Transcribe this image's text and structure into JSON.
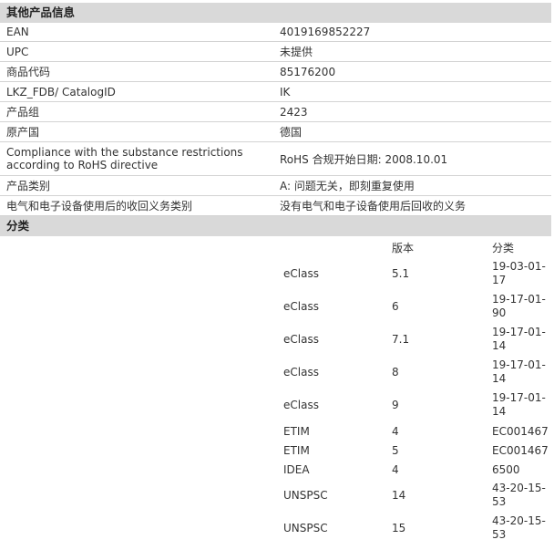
{
  "other_info": {
    "title": "其他产品信息",
    "rows": [
      {
        "label": "EAN",
        "value": "4019169852227"
      },
      {
        "label": "UPC",
        "value": "未提供"
      },
      {
        "label": "商品代码",
        "value": "85176200"
      },
      {
        "label": "LKZ_FDB/ CatalogID",
        "value": "IK"
      },
      {
        "label": "产品组",
        "value": "2423"
      },
      {
        "label": "原产国",
        "value": "德国"
      },
      {
        "label": "Compliance with the substance restrictions according to RoHS directive",
        "value": "RoHS 合规开始日期: 2008.10.01"
      },
      {
        "label": "产品类别",
        "value": "A: 问题无关，即刻重复使用"
      },
      {
        "label": "电气和电子设备使用后的收回义务类别",
        "value": "没有电气和电子设备使用后回收的义务"
      }
    ]
  },
  "classification": {
    "title": "分类",
    "col_version": "版本",
    "col_category": "分类",
    "rows": [
      {
        "system": "eClass",
        "version": "5.1",
        "category": "19-03-01-17"
      },
      {
        "system": "eClass",
        "version": "6",
        "category": "19-17-01-90"
      },
      {
        "system": "eClass",
        "version": "7.1",
        "category": "19-17-01-14"
      },
      {
        "system": "eClass",
        "version": "8",
        "category": "19-17-01-14"
      },
      {
        "system": "eClass",
        "version": "9",
        "category": "19-17-01-14"
      },
      {
        "system": "ETIM",
        "version": "4",
        "category": "EC001467"
      },
      {
        "system": "ETIM",
        "version": "5",
        "category": "EC001467"
      },
      {
        "system": "IDEA",
        "version": "4",
        "category": "6500"
      },
      {
        "system": "UNSPSC",
        "version": "14",
        "category": "43-20-15-53"
      },
      {
        "system": "UNSPSC",
        "version": "15",
        "category": "43-20-15-53"
      }
    ]
  }
}
